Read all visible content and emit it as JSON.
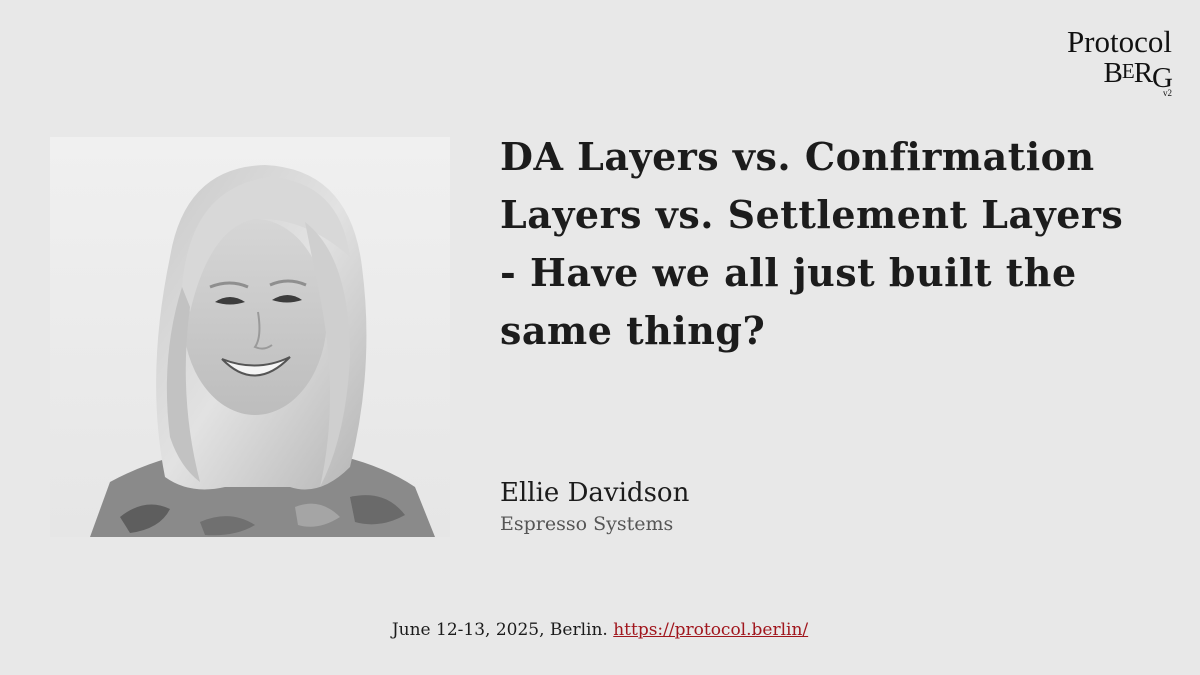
{
  "logo": {
    "line1": "Protocol",
    "berg_b": "B",
    "berg_e": "E",
    "berg_r": "R",
    "berg_g": "G",
    "version": "v2"
  },
  "talk": {
    "title": "DA Layers vs. Confirmation Layers vs. Settlement Layers - Have we all just built the same thing?"
  },
  "speaker": {
    "name": "Ellie Davidson",
    "organization": "Espresso Systems"
  },
  "footer": {
    "event_text": "June 12-13, 2025, Berlin.",
    "link_text": "https://protocol.berlin/"
  },
  "colors": {
    "background": "#e8e8e8",
    "link": "#a0161d",
    "text": "#1c1c1c"
  }
}
